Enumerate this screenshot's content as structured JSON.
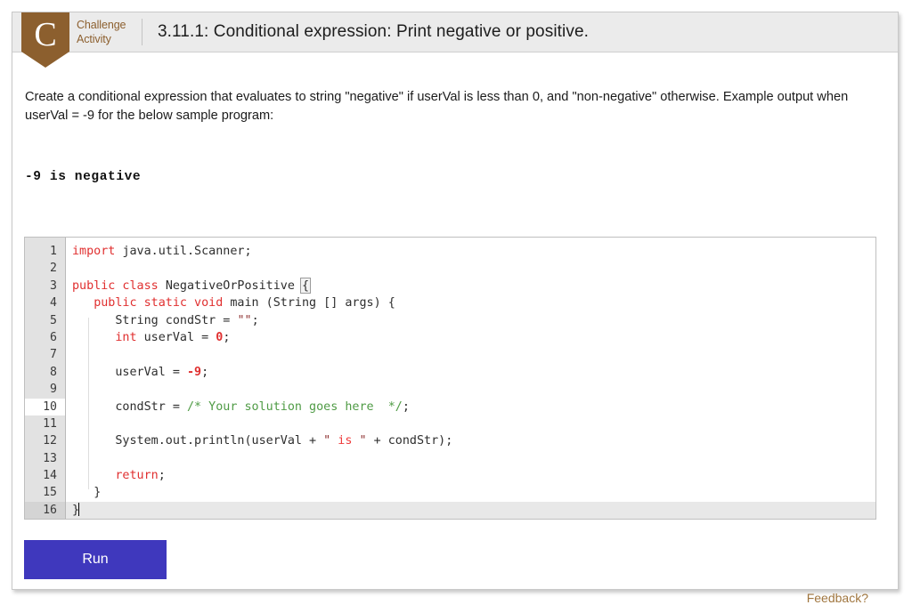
{
  "header": {
    "badge_letter": "C",
    "badge_line1": "Challenge",
    "badge_line2": "Activity",
    "badge_color": "#8c5f2e",
    "title": "3.11.1: Conditional expression: Print negative or positive."
  },
  "content": {
    "prompt": "Create a conditional expression that evaluates to string \"negative\" if userVal is less than 0, and \"non-negative\" otherwise. Example output when userVal = -9 for the below sample program:",
    "sample_output": "-9 is negative"
  },
  "editor": {
    "language": "java",
    "active_line": 10,
    "caret_line": 16,
    "line_numbers": [
      "1",
      "2",
      "3",
      "4",
      "5",
      "6",
      "7",
      "8",
      "9",
      "10",
      "11",
      "12",
      "13",
      "14",
      "15",
      "16"
    ],
    "lines": [
      "import java.util.Scanner;",
      "",
      "public class NegativeOrPositive {",
      "   public static void main (String [] args) {",
      "      String condStr = \"\";",
      "      int userVal = 0;",
      "",
      "      userVal = -9;",
      "",
      "      condStr = /* Your solution goes here  */;",
      "",
      "      System.out.println(userVal + \" is \" + condStr);",
      "",
      "      return;",
      "   }",
      "}"
    ]
  },
  "controls": {
    "run_label": "Run",
    "run_color": "#3f38bd",
    "feedback_label": "Feedback?",
    "feedback_color": "#a0763f"
  }
}
